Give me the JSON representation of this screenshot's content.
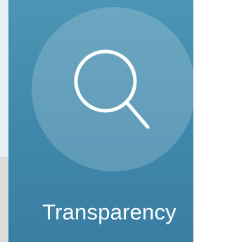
{
  "tile": {
    "label": "Transparency",
    "icon": "search-icon"
  },
  "colors": {
    "tile_top": "#4c95b4",
    "tile_bottom": "#3a7ea3",
    "left_strip": "#e6f1f6",
    "page_bg": "#dcdcdc",
    "label_text": "#ffffff"
  }
}
